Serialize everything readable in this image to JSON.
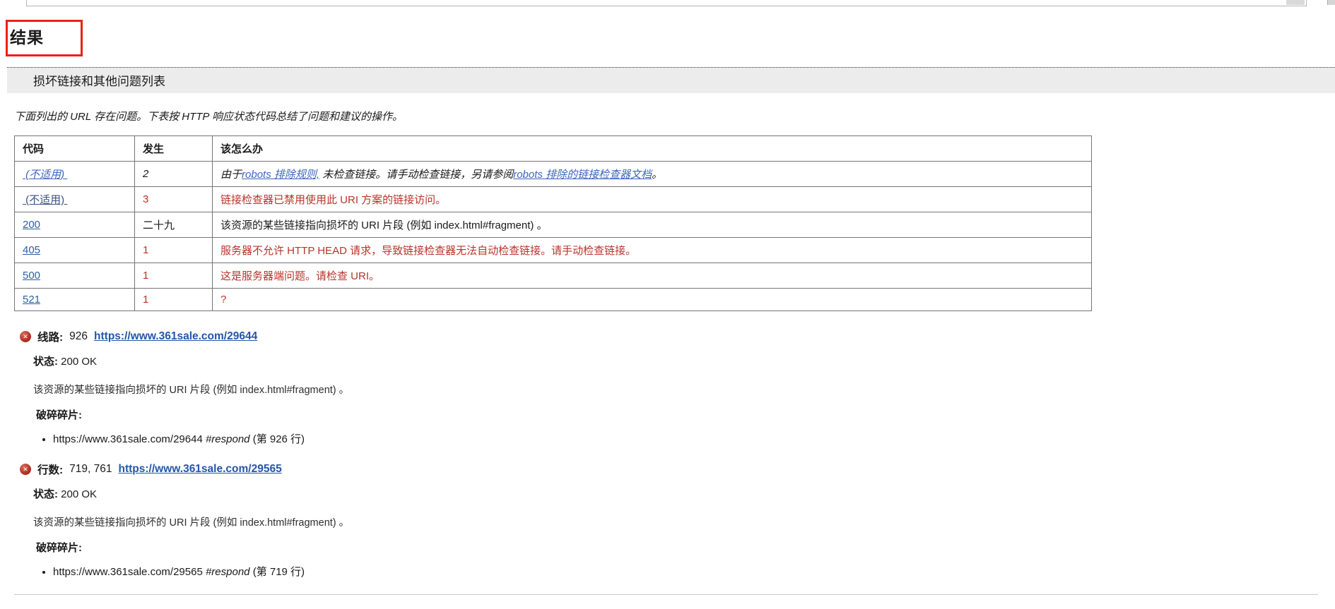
{
  "page": {
    "title": "结果",
    "section_header": "损坏链接和其他问题列表",
    "intro": "下面列出的 URL 存在问题。下表按 HTTP 响应状态代码总结了问题和建议的操作。"
  },
  "colors": {
    "link_blue": "#2b5fa3",
    "link_italic_blue": "#3c66bf",
    "visited_navy": "#3a5380",
    "error_red": "#b8342a",
    "annotation_red": "#ec2115"
  },
  "icons": {
    "error_glyph": "✕"
  },
  "summary_table": {
    "headers": [
      "代码",
      "发生",
      "该怎么办"
    ],
    "rows": [
      {
        "code": " (不适用) ",
        "code_style": "italic-link",
        "count": "2",
        "count_style": "italic",
        "message_style": "italic",
        "message_parts": [
          {
            "type": "text",
            "text": "由于"
          },
          {
            "type": "link",
            "text": "robots 排除规则,"
          },
          {
            "type": "text",
            "text": " 未检查链接。请手动检查链接，另请参阅"
          },
          {
            "type": "link",
            "text": "robots 排除的链接检查器文档"
          },
          {
            "type": "text",
            "text": "。"
          }
        ]
      },
      {
        "code": " (不适用) ",
        "code_style": "visited-link",
        "count": "3",
        "count_style": "error",
        "message_style": "error",
        "message": "链接检查器已禁用使用此 URI 方案的链接访问。"
      },
      {
        "code": "200",
        "code_style": "link",
        "count": "二十九",
        "count_style": "plain",
        "message_style": "plain",
        "message": "该资源的某些链接指向损坏的 URI 片段 (例如 index.html#fragment) 。"
      },
      {
        "code": "405",
        "code_style": "link",
        "count": "1",
        "count_style": "error",
        "message_style": "error",
        "message": "服务器不允许 HTTP HEAD 请求，导致链接检查器无法自动检查链接。请手动检查链接。"
      },
      {
        "code": "500",
        "code_style": "link",
        "count": "1",
        "count_style": "error",
        "message_style": "error",
        "message": "这是服务器端问题。请检查 URI。"
      },
      {
        "code": "521",
        "code_style": "link",
        "count": "1",
        "count_style": "error",
        "message_style": "error",
        "message": "?"
      }
    ]
  },
  "details": [
    {
      "line_label": "线路:",
      "line_value": "926",
      "url": "https://www.361sale.com/29644",
      "status_label": "状态:",
      "status_value": "200 OK",
      "description": "该资源的某些链接指向损坏的 URI 片段 (例如 index.html#fragment) 。",
      "fragments_label": "破碎碎片:",
      "fragments": [
        {
          "url": "https://www.361sale.com/29644",
          "fragment": "#respond",
          "line_ref": "(第 926 行)"
        }
      ]
    },
    {
      "line_label": "行数:",
      "line_value": "719, 761",
      "url": "https://www.361sale.com/29565",
      "status_label": "状态:",
      "status_value": "200 OK",
      "description": "该资源的某些链接指向损坏的 URI 片段 (例如 index.html#fragment) 。",
      "fragments_label": "破碎碎片:",
      "fragments": [
        {
          "url": "https://www.361sale.com/29565",
          "fragment": "#respond",
          "line_ref": "(第 719 行)"
        }
      ]
    }
  ]
}
